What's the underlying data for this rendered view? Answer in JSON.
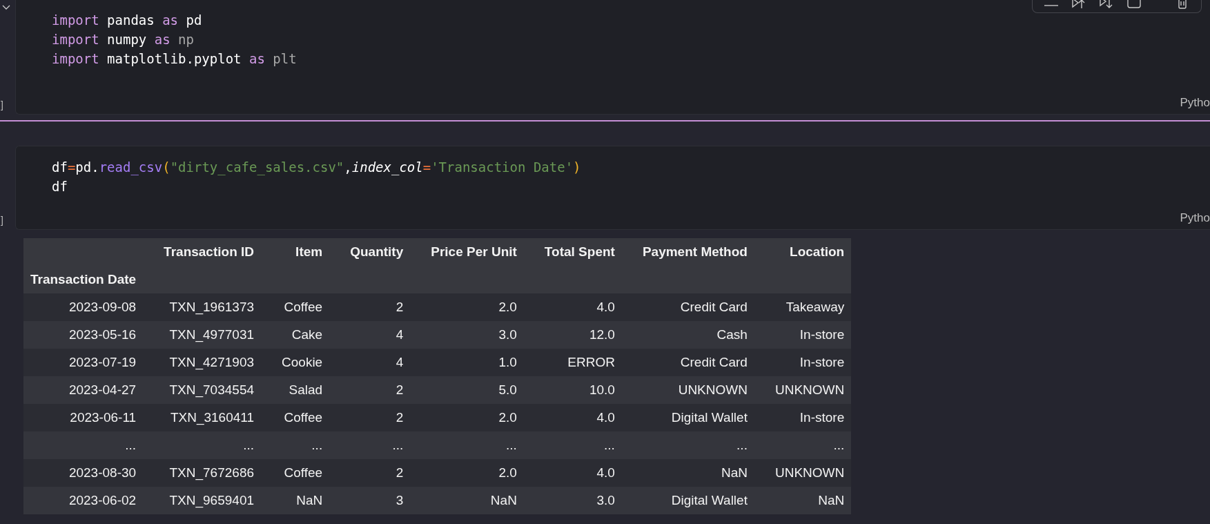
{
  "cells": [
    {
      "kind": "code",
      "collapsed": false,
      "prompt": "]",
      "language": "Pytho",
      "toolbar": true,
      "lines": [
        [
          {
            "text": "import",
            "kind": "keyword"
          },
          {
            "text": " pandas",
            "kind": "name"
          },
          {
            "text": " as",
            "kind": "keyword"
          },
          {
            "text": " pd",
            "kind": "name"
          }
        ],
        [
          {
            "text": "import",
            "kind": "keyword"
          },
          {
            "text": " numpy",
            "kind": "name"
          },
          {
            "text": " as",
            "kind": "keyword"
          },
          {
            "text": " np",
            "kind": "unused"
          }
        ],
        [
          {
            "text": "import",
            "kind": "keyword"
          },
          {
            "text": " matplotlib.pyplot",
            "kind": "name"
          },
          {
            "text": " as",
            "kind": "keyword"
          },
          {
            "text": " plt",
            "kind": "unused"
          }
        ]
      ]
    },
    {
      "kind": "code",
      "prompt": "]",
      "language": "Pytho",
      "toolbar": false,
      "lines": [
        [
          {
            "text": "df",
            "kind": "name"
          },
          {
            "text": "=",
            "kind": "operator"
          },
          {
            "text": "pd.",
            "kind": "name"
          },
          {
            "text": "read_csv",
            "kind": "function"
          },
          {
            "text": "(",
            "kind": "paren"
          },
          {
            "text": "\"dirty_cafe_sales.csv\"",
            "kind": "string"
          },
          {
            "text": ",",
            "kind": "name"
          },
          {
            "text": "index_col",
            "kind": "param"
          },
          {
            "text": "=",
            "kind": "operator"
          },
          {
            "text": "'Transaction Date'",
            "kind": "string"
          },
          {
            "text": ")",
            "kind": "paren"
          }
        ],
        [
          {
            "text": "df",
            "kind": "name"
          }
        ]
      ],
      "output": {
        "kind": "table",
        "columns": [
          "Transaction ID",
          "Item",
          "Quantity",
          "Price Per Unit",
          "Total Spent",
          "Payment Method",
          "Location"
        ],
        "index_name": "Transaction Date",
        "rows": [
          {
            "index": "2023-09-08",
            "cells": [
              "TXN_1961373",
              "Coffee",
              "2",
              "2.0",
              "4.0",
              "Credit Card",
              "Takeaway"
            ]
          },
          {
            "index": "2023-05-16",
            "cells": [
              "TXN_4977031",
              "Cake",
              "4",
              "3.0",
              "12.0",
              "Cash",
              "In-store"
            ]
          },
          {
            "index": "2023-07-19",
            "cells": [
              "TXN_4271903",
              "Cookie",
              "4",
              "1.0",
              "ERROR",
              "Credit Card",
              "In-store"
            ]
          },
          {
            "index": "2023-04-27",
            "cells": [
              "TXN_7034554",
              "Salad",
              "2",
              "5.0",
              "10.0",
              "UNKNOWN",
              "UNKNOWN"
            ]
          },
          {
            "index": "2023-06-11",
            "cells": [
              "TXN_3160411",
              "Coffee",
              "2",
              "2.0",
              "4.0",
              "Digital Wallet",
              "In-store"
            ]
          },
          {
            "index": "...",
            "cells": [
              "...",
              "...",
              "...",
              "...",
              "...",
              "...",
              "..."
            ]
          },
          {
            "index": "2023-08-30",
            "cells": [
              "TXN_7672686",
              "Coffee",
              "2",
              "2.0",
              "4.0",
              "NaN",
              "UNKNOWN"
            ]
          },
          {
            "index": "2023-06-02",
            "cells": [
              "TXN_9659401",
              "NaN",
              "3",
              "NaN",
              "3.0",
              "Digital Wallet",
              "NaN"
            ]
          }
        ]
      }
    }
  ]
}
